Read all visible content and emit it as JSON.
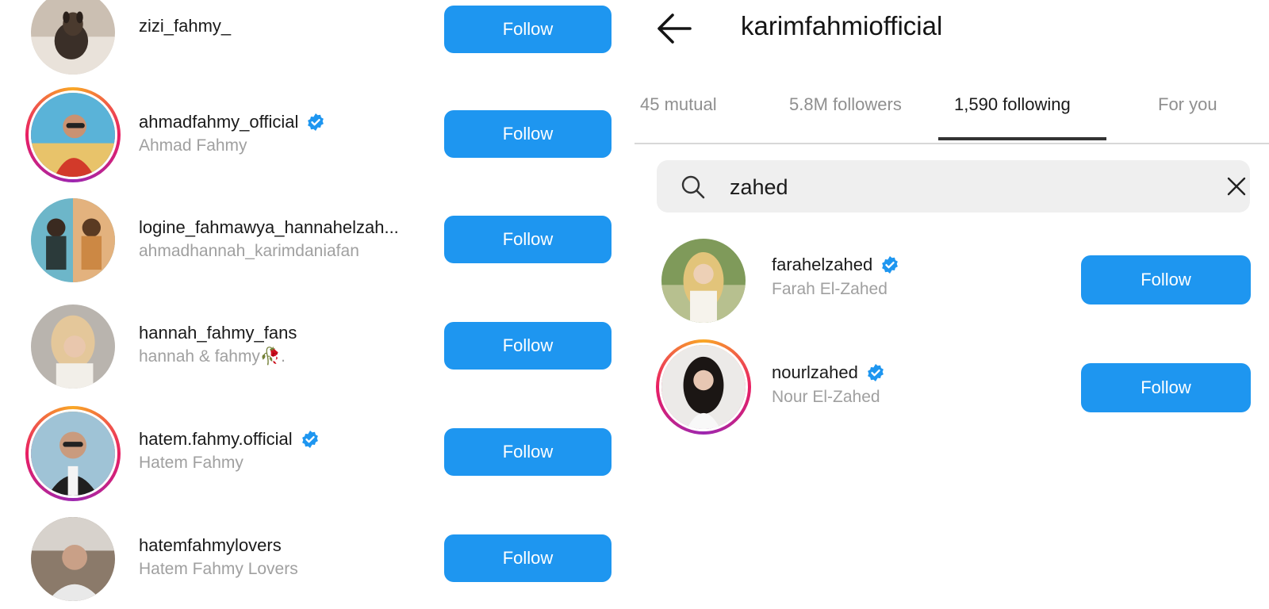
{
  "colors": {
    "follow_button": "#1e96f0",
    "verified_badge": "#1e96f0",
    "muted_text": "#a0a0a0"
  },
  "left_list": [
    {
      "username": "zizi_fahmy_",
      "full_name": "",
      "verified": false,
      "story_ring": false,
      "button": "Follow"
    },
    {
      "username": "ahmadfahmy_official",
      "full_name": "Ahmad Fahmy",
      "verified": true,
      "story_ring": true,
      "button": "Follow"
    },
    {
      "username": "logine_fahmawya_hannahelzah...",
      "full_name": "ahmadhannah_karimdaniafan",
      "verified": false,
      "story_ring": false,
      "button": "Follow"
    },
    {
      "username": "hannah_fahmy_fans",
      "full_name": "hannah & fahmy🥀.",
      "verified": false,
      "story_ring": false,
      "button": "Follow"
    },
    {
      "username": "hatem.fahmy.official",
      "full_name": "Hatem Fahmy",
      "verified": true,
      "story_ring": true,
      "button": "Follow"
    },
    {
      "username": "hatemfahmylovers",
      "full_name": "Hatem Fahmy Lovers",
      "verified": false,
      "story_ring": false,
      "button": "Follow"
    }
  ],
  "profile": {
    "username": "karimfahmiofficial",
    "back_icon": "arrow-left-icon"
  },
  "tabs": [
    {
      "label": "45 mutual",
      "active": false
    },
    {
      "label": "5.8M followers",
      "active": false
    },
    {
      "label": "1,590 following",
      "active": true
    },
    {
      "label": "For you",
      "active": false
    }
  ],
  "search": {
    "value": "zahed",
    "icon": "search-icon",
    "clear_icon": "close-icon"
  },
  "results": [
    {
      "username": "farahelzahed",
      "full_name": "Farah El-Zahed",
      "verified": true,
      "story_ring": false,
      "button": "Follow"
    },
    {
      "username": "nourlzahed",
      "full_name": "Nour El-Zahed",
      "verified": true,
      "story_ring": true,
      "button": "Follow"
    }
  ]
}
